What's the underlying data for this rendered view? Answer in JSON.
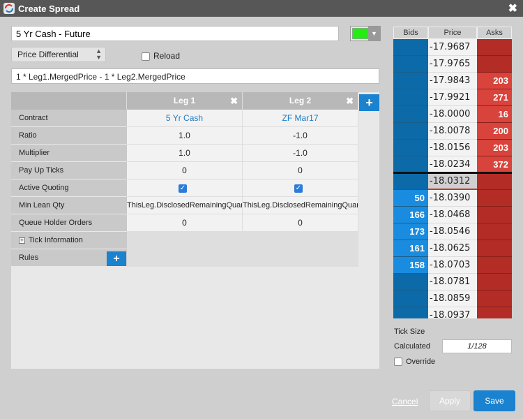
{
  "window": {
    "title": "Create Spread",
    "close_icon": "close-icon"
  },
  "spread": {
    "name": "5 Yr Cash - Future",
    "color": "#22ee11",
    "mode": "Price Differential",
    "reload_label": "Reload",
    "reload_checked": false,
    "formula": "1 * Leg1.MergedPrice - 1 * Leg2.MergedPrice"
  },
  "grid": {
    "legs": [
      {
        "label": "Leg 1"
      },
      {
        "label": "Leg 2"
      }
    ],
    "rows": {
      "contract": {
        "label": "Contract",
        "values": [
          "5 Yr Cash",
          "ZF Mar17"
        ]
      },
      "ratio": {
        "label": "Ratio",
        "values": [
          "1.0",
          "-1.0"
        ]
      },
      "multiplier": {
        "label": "Multiplier",
        "values": [
          "1.0",
          "-1.0"
        ]
      },
      "payup": {
        "label": "Pay Up Ticks",
        "values": [
          "0",
          "0"
        ]
      },
      "active_quoting": {
        "label": "Active Quoting",
        "values": [
          true,
          true
        ]
      },
      "min_lean": {
        "label": "Min Lean Qty",
        "values": [
          "ThisLeg.DisclosedRemainingQuantity",
          "ThisLeg.DisclosedRemainingQuantity"
        ]
      },
      "queue_holder": {
        "label": "Queue Holder Orders",
        "values": [
          "0",
          "0"
        ]
      },
      "tick_info": {
        "label": "Tick Information"
      },
      "rules": {
        "label": "Rules"
      }
    }
  },
  "ladder": {
    "headers": {
      "bids": "Bids",
      "price": "Price",
      "asks": "Asks"
    },
    "rows": [
      {
        "price": "-17.9687",
        "bid": "",
        "ask": ""
      },
      {
        "price": "-17.9765",
        "bid": "",
        "ask": ""
      },
      {
        "price": "-17.9843",
        "bid": "",
        "ask": "203"
      },
      {
        "price": "-17.9921",
        "bid": "",
        "ask": "271"
      },
      {
        "price": "-18.0000",
        "bid": "",
        "ask": "16"
      },
      {
        "price": "-18.0078",
        "bid": "",
        "ask": "200"
      },
      {
        "price": "-18.0156",
        "bid": "",
        "ask": "203"
      },
      {
        "price": "-18.0234",
        "bid": "",
        "ask": "372"
      },
      {
        "price": "-18.0312",
        "bid": "",
        "ask": ""
      },
      {
        "price": "-18.0390",
        "bid": "50",
        "ask": ""
      },
      {
        "price": "-18.0468",
        "bid": "166",
        "ask": ""
      },
      {
        "price": "-18.0546",
        "bid": "173",
        "ask": ""
      },
      {
        "price": "-18.0625",
        "bid": "161",
        "ask": ""
      },
      {
        "price": "-18.0703",
        "bid": "158",
        "ask": ""
      },
      {
        "price": "-18.0781",
        "bid": "",
        "ask": ""
      },
      {
        "price": "-18.0859",
        "bid": "",
        "ask": ""
      },
      {
        "price": "-18.0937",
        "bid": "",
        "ask": ""
      }
    ]
  },
  "tick": {
    "size_label": "Tick Size",
    "calculated_label": "Calculated",
    "calculated_value": "1/128",
    "override_label": "Override",
    "override_checked": false
  },
  "footer": {
    "cancel": "Cancel",
    "apply": "Apply",
    "save": "Save"
  }
}
